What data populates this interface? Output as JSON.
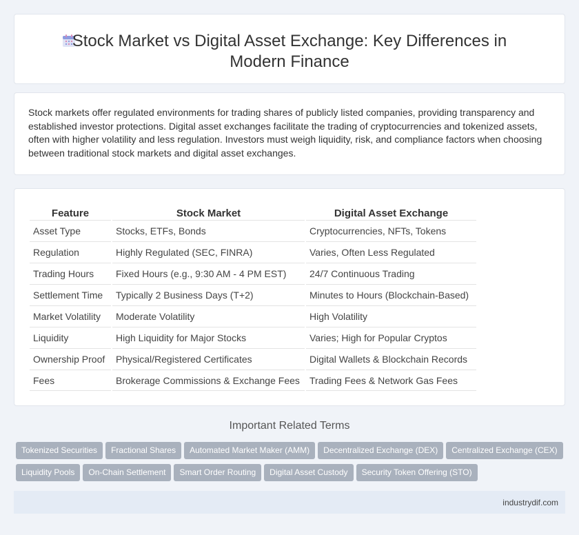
{
  "page": {
    "title": "Stock Market vs Digital Asset Exchange: Key Differences in Modern Finance",
    "icon": "calendar-icon",
    "intro": "Stock markets offer regulated environments for trading shares of publicly listed companies, providing transparency and established investor protections. Digital asset exchanges facilitate the trading of cryptocurrencies and tokenized assets, often with higher volatility and less regulation. Investors must weigh liquidity, risk, and compliance factors when choosing between traditional stock markets and digital asset exchanges."
  },
  "table": {
    "headers": [
      "Feature",
      "Stock Market",
      "Digital Asset Exchange"
    ],
    "rows": [
      [
        "Asset Type",
        "Stocks, ETFs, Bonds",
        "Cryptocurrencies, NFTs, Tokens"
      ],
      [
        "Regulation",
        "Highly Regulated (SEC, FINRA)",
        "Varies, Often Less Regulated"
      ],
      [
        "Trading Hours",
        "Fixed Hours (e.g., 9:30 AM - 4 PM EST)",
        "24/7 Continuous Trading"
      ],
      [
        "Settlement Time",
        "Typically 2 Business Days (T+2)",
        "Minutes to Hours (Blockchain-Based)"
      ],
      [
        "Market Volatility",
        "Moderate Volatility",
        "High Volatility"
      ],
      [
        "Liquidity",
        "High Liquidity for Major Stocks",
        "Varies; High for Popular Cryptos"
      ],
      [
        "Ownership Proof",
        "Physical/Registered Certificates",
        "Digital Wallets & Blockchain Records"
      ],
      [
        "Fees",
        "Brokerage Commissions & Exchange Fees",
        "Trading Fees & Network Gas Fees"
      ]
    ]
  },
  "related": {
    "heading": "Important Related Terms",
    "tags": [
      "Tokenized Securities",
      "Fractional Shares",
      "Automated Market Maker (AMM)",
      "Decentralized Exchange (DEX)",
      "Centralized Exchange (CEX)",
      "Liquidity Pools",
      "On-Chain Settlement",
      "Smart Order Routing",
      "Digital Asset Custody",
      "Security Token Offering (STO)"
    ]
  },
  "footer": {
    "site": "industrydif.com"
  },
  "colors": {
    "tag_bg": "#a9b1bd",
    "footer_bg": "#e4ebf5",
    "page_bg": "#f0f3f8"
  }
}
